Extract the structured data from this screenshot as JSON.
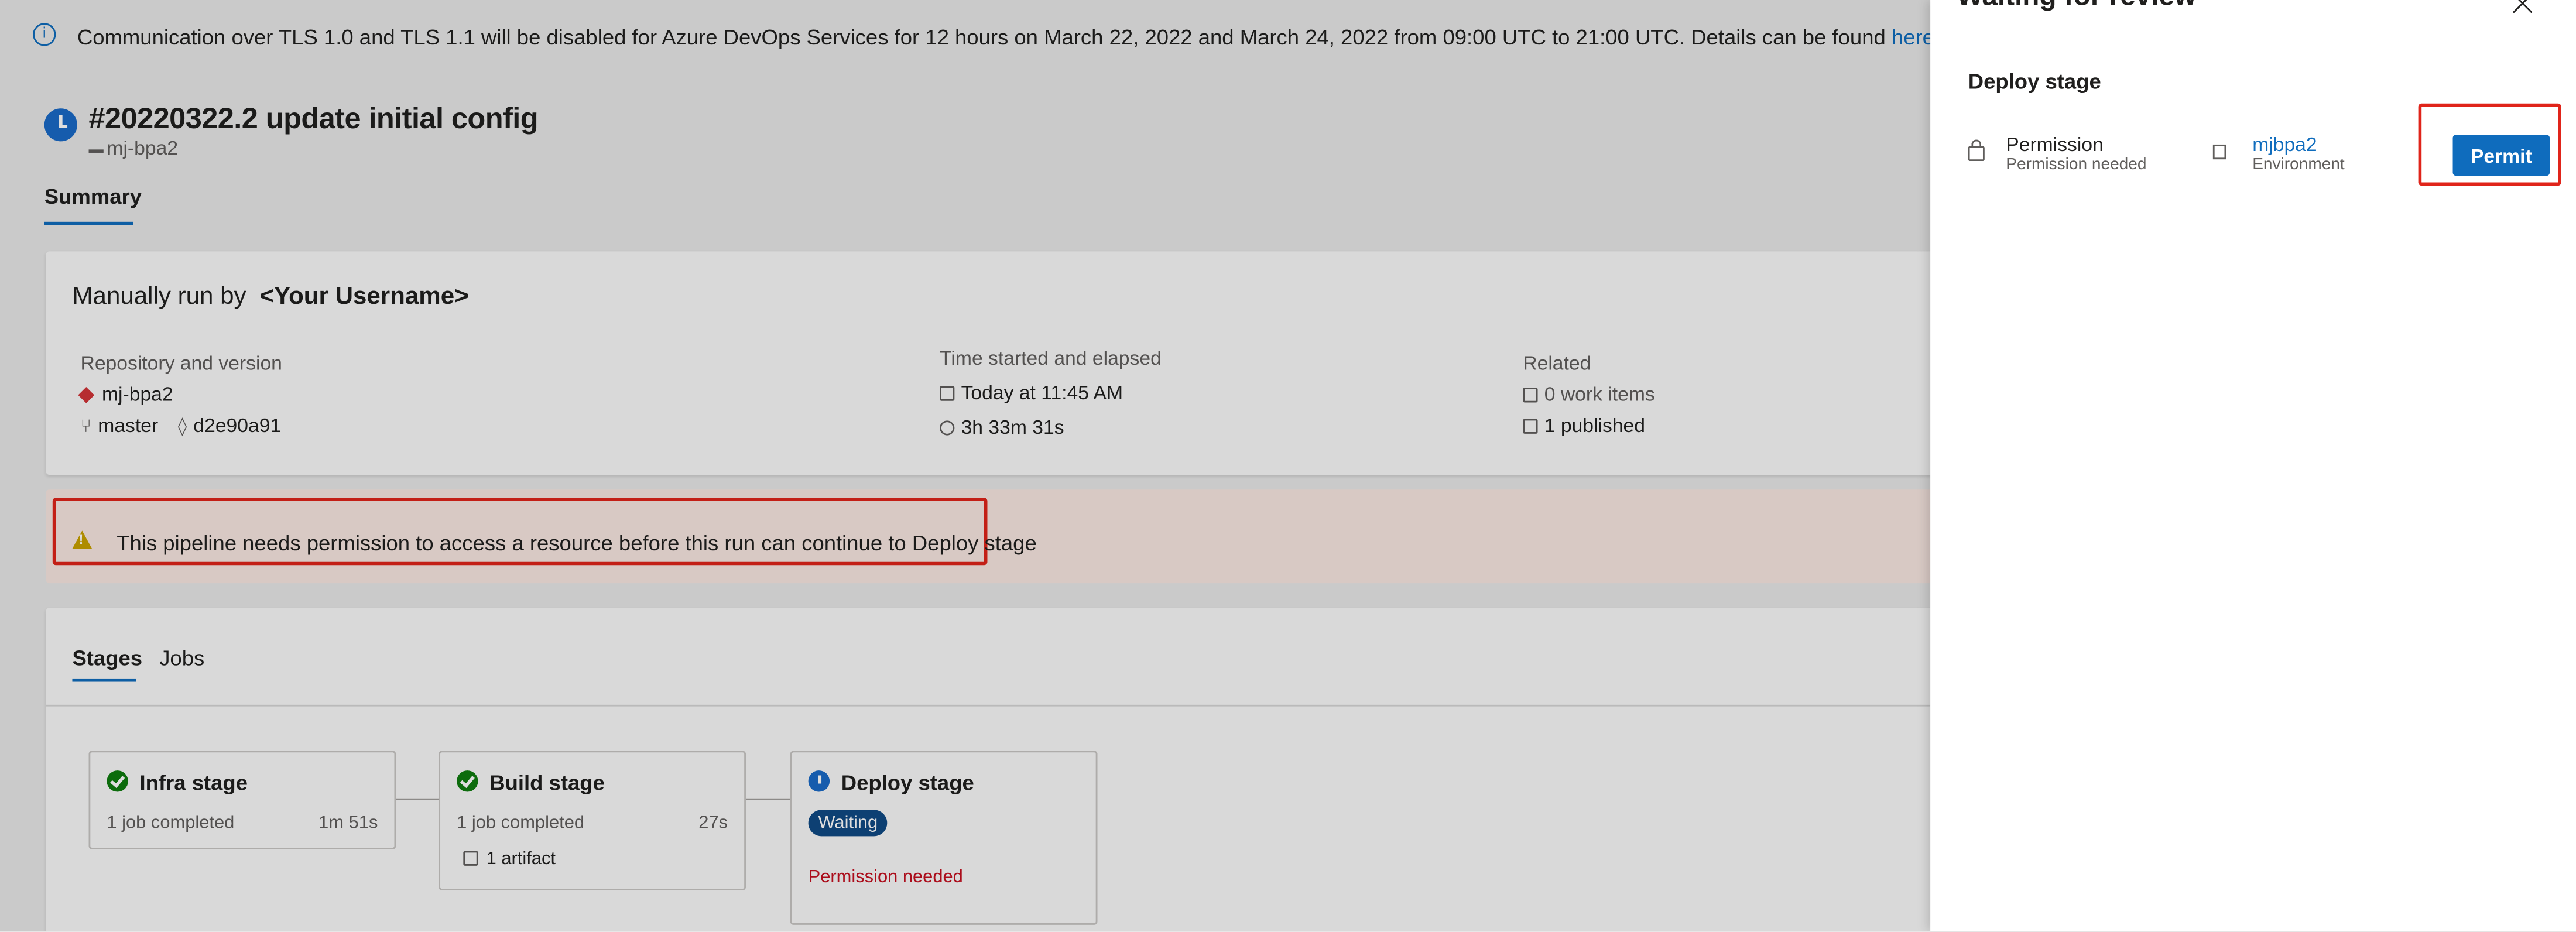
{
  "banner": {
    "text": "Communication over TLS 1.0 and TLS 1.1 will be disabled for Azure DevOps Services for 12 hours on March 22, 2022 and March 24, 2022 from 09:00 UTC to 21:00 UTC. Details can be found ",
    "link": "here",
    "suffix": "."
  },
  "run": {
    "title": "#20220322.2 update initial config",
    "repo": "mj-bpa2",
    "tab": "Summary"
  },
  "summary": {
    "manual_label": "Manually run by",
    "user": "<Your Username>",
    "repo_version_label": "Repository and version",
    "repo": "mj-bpa2",
    "branch": "master",
    "commit": "d2e90a91",
    "time_label": "Time started and elapsed",
    "started": "Today at 11:45 AM",
    "elapsed": "3h 33m 31s",
    "related_label": "Related",
    "work_items": "0 work items",
    "published": "1 published"
  },
  "warning": {
    "text": "This pipeline needs permission to access a resource before this run can continue to Deploy stage"
  },
  "stages_card": {
    "tabs": [
      "Stages",
      "Jobs"
    ],
    "stages": [
      {
        "name": "Infra stage",
        "meta": "1 job completed",
        "duration": "1m 51s"
      },
      {
        "name": "Build stage",
        "meta": "1 job completed",
        "duration": "27s",
        "artifact": "1 artifact"
      },
      {
        "name": "Deploy stage",
        "badge": "Waiting",
        "status": "Permission needed"
      }
    ]
  },
  "panel": {
    "title": "Waiting for review",
    "section": "Deploy stage",
    "permission_title": "Permission",
    "permission_sub": "Permission needed",
    "env_name": "mjbpa2",
    "env_sub": "Environment",
    "permit_label": "Permit"
  },
  "colors": {
    "accent": "#0f6cbd",
    "success": "#107c10",
    "error": "#c50f1f",
    "highlight": "#e0241a"
  }
}
